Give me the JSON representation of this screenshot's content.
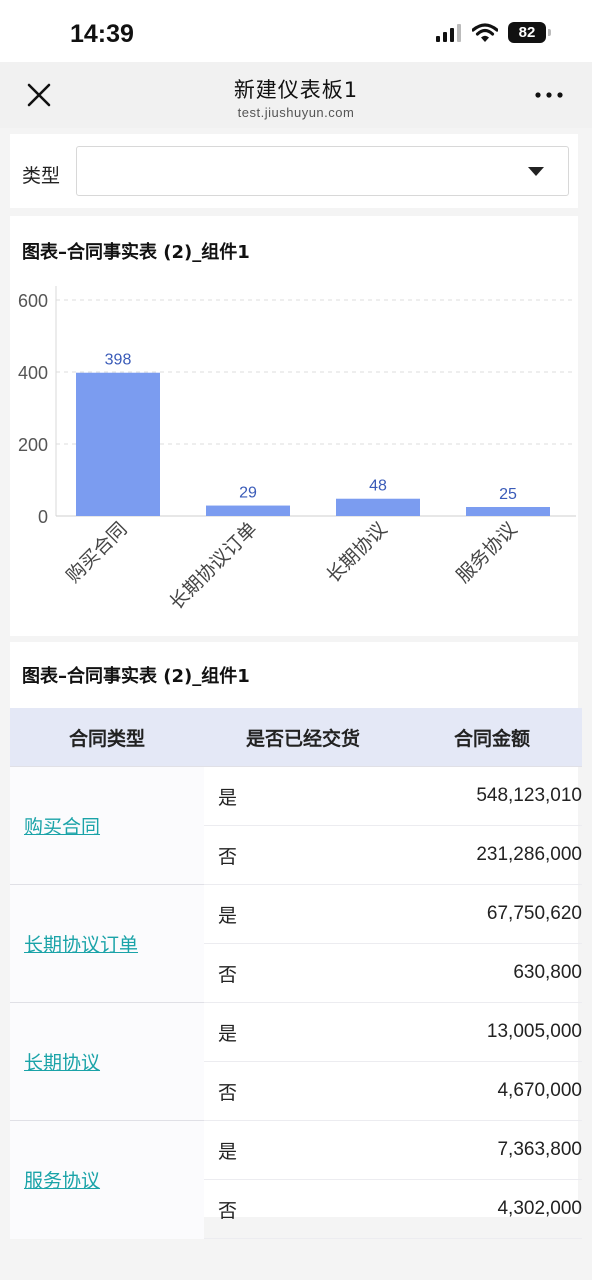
{
  "status": {
    "time": "14:39",
    "battery": "82"
  },
  "nav": {
    "title": "新建仪表板1",
    "subtitle": "test.jiushuyun.com"
  },
  "filter": {
    "label": "类型",
    "value": ""
  },
  "chart_card": {
    "title": "图表–合同事实表 (2)_组件1"
  },
  "chart_data": {
    "type": "bar",
    "categories": [
      "购买合同",
      "长期协议订单",
      "长期协议",
      "服务协议"
    ],
    "values": [
      398,
      29,
      48,
      25
    ],
    "ylim": [
      0,
      600
    ],
    "yticks": [
      0,
      200,
      400,
      600
    ],
    "grid": true,
    "bar_color": "#7b9cf0",
    "label_color": "#3a5bb8"
  },
  "table_card": {
    "title": "图表–合同事实表 (2)_组件1",
    "columns": [
      "合同类型",
      "是否已经交货",
      "合同金额"
    ],
    "groups": [
      {
        "type": "购买合同",
        "rows": [
          {
            "delivered": "是",
            "amount": "548,123,010"
          },
          {
            "delivered": "否",
            "amount": "231,286,000"
          }
        ]
      },
      {
        "type": "长期协议订单",
        "rows": [
          {
            "delivered": "是",
            "amount": "67,750,620"
          },
          {
            "delivered": "否",
            "amount": "630,800"
          }
        ]
      },
      {
        "type": "长期协议",
        "rows": [
          {
            "delivered": "是",
            "amount": "13,005,000"
          },
          {
            "delivered": "否",
            "amount": "4,670,000"
          }
        ]
      },
      {
        "type": "服务协议",
        "rows": [
          {
            "delivered": "是",
            "amount": "7,363,800"
          },
          {
            "delivered": "否",
            "amount": "4,302,000"
          }
        ]
      }
    ]
  }
}
